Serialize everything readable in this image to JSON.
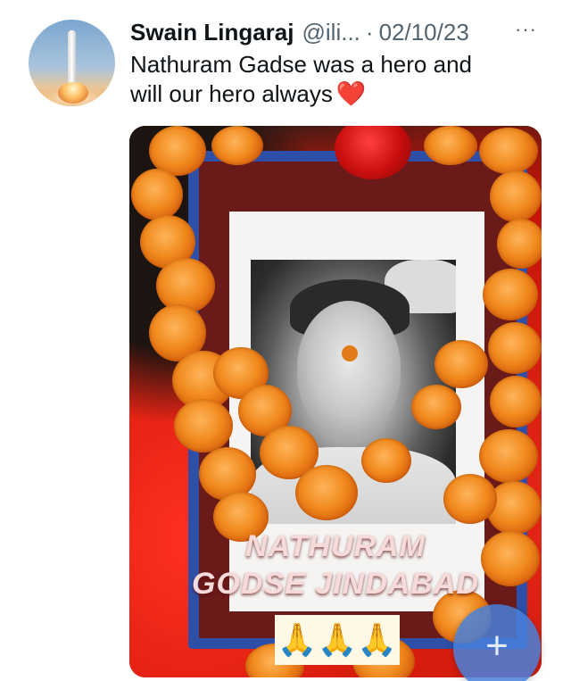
{
  "tweet": {
    "author_name": "Swain Lingaraj",
    "author_handle": "@ili...",
    "separator": "·",
    "date": "02/10/23",
    "more_icon": "···",
    "text_line1": "Nathuram Gadse was a hero and",
    "text_line2": "will our hero always",
    "heart_emoji": "❤️"
  },
  "media": {
    "banner_line1": "NATHURAM",
    "banner_line2": "GODSE JINDABAD",
    "hands_emoji": "🙏🙏🙏"
  },
  "compose_button": {
    "icon": "+"
  },
  "colors": {
    "text_primary": "#0f1419",
    "text_secondary": "#536471",
    "heart": "#e0102f",
    "fab": "#4880da"
  }
}
